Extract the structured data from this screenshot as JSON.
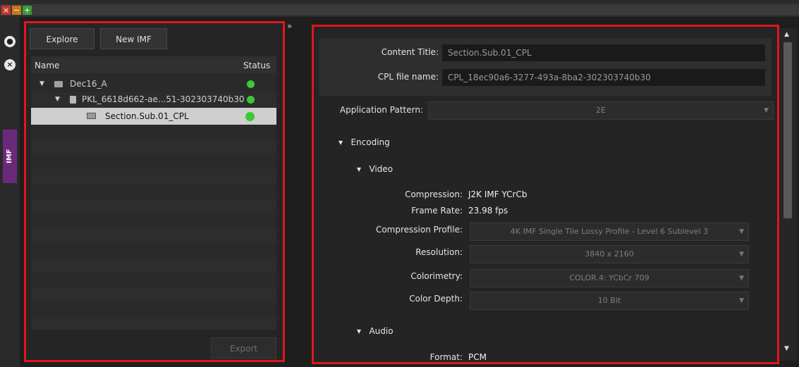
{
  "left_panel": {
    "explore_label": "Explore",
    "new_imf_label": "New IMF",
    "export_label": "Export",
    "tree": {
      "col_name": "Name",
      "col_status": "Status",
      "rows": [
        {
          "label": "Dec16_A"
        },
        {
          "label": "PKL_6618d662-ae...51-302303740b30"
        },
        {
          "label": "Section.Sub.01_CPL"
        }
      ]
    }
  },
  "side_tab": {
    "label": "IMF"
  },
  "right_panel": {
    "content_title_label": "Content Title:",
    "content_title_value": "Section.Sub.01_CPL",
    "cpl_file_label": "CPL file name:",
    "cpl_file_value": "CPL_18ec90a6-3277-493a-8ba2-302303740b30",
    "app_pattern_label": "Application Pattern:",
    "app_pattern_value": "2E",
    "encoding_label": "Encoding",
    "video_label": "Video",
    "compression_label": "Compression:",
    "compression_value": "J2K IMF YCrCb",
    "frame_rate_label": "Frame Rate:",
    "frame_rate_value": "23.98 fps",
    "compression_profile_label": "Compression Profile:",
    "compression_profile_value": "4K IMF Single Tile Lossy Profile - Level 6 Sublevel 3",
    "resolution_label": "Resolution:",
    "resolution_value": "3840 x 2160",
    "colorimetry_label": "Colorimetry:",
    "colorimetry_value": "COLOR.4: YCbCr 709",
    "color_depth_label": "Color Depth:",
    "color_depth_value": "10 Bit",
    "audio_label": "Audio",
    "format_label": "Format:",
    "format_value": "PCM"
  },
  "colors": {
    "accent_red": "#e3151b",
    "status_green": "#3fc73a",
    "imf_tab": "#6a2a7a"
  }
}
